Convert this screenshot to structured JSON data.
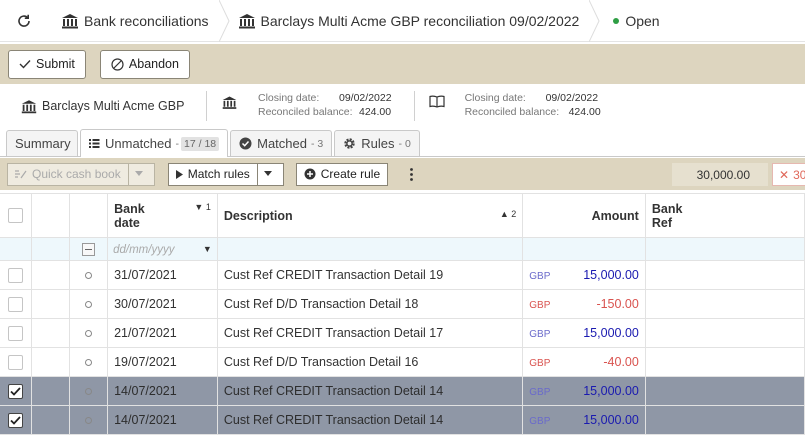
{
  "breadcrumb": {
    "item1": "Bank reconciliations",
    "item2": "Barclays Multi Acme GBP reconciliation 09/02/2022",
    "status": "Open"
  },
  "actions": {
    "submit": "Submit",
    "abandon": "Abandon"
  },
  "info": {
    "account": "Barclays Multi Acme GBP",
    "closing_date_label": "Closing date:",
    "closing_date_1": "09/02/2022",
    "reconciled_balance_label": "Reconciled balance:",
    "reconciled_balance_1": "424.00",
    "closing_date_2": "09/02/2022",
    "reconciled_balance_2": "424.00"
  },
  "tabs": {
    "summary": "Summary",
    "unmatched": "Unmatched",
    "unmatched_count": "17",
    "unmatched_total": "18",
    "matched": "Matched",
    "matched_count": "3",
    "rules": "Rules",
    "rules_count": "0"
  },
  "toolbar": {
    "quick_cash_book": "Quick cash book",
    "match_rules": "Match rules",
    "create_rule": "Create rule",
    "total": "30,000.00",
    "clear": "30"
  },
  "columns": {
    "bank_date_1": "Bank",
    "bank_date_2": "date",
    "bank_date_sort": "1",
    "description": "Description",
    "description_sort": "2",
    "amount": "Amount",
    "bank_ref_1": "Bank",
    "bank_ref_2": "Ref",
    "date_placeholder": "dd/mm/yyyy"
  },
  "rows": [
    {
      "date": "31/07/2021",
      "desc": "Cust Ref CREDIT Transaction Detail 19",
      "cur": "GBP",
      "amount": "15,000.00",
      "neg": false,
      "checked": false
    },
    {
      "date": "30/07/2021",
      "desc": "Cust Ref D/D Transaction Detail 18",
      "cur": "GBP",
      "amount": "-150.00",
      "neg": true,
      "checked": false
    },
    {
      "date": "21/07/2021",
      "desc": "Cust Ref CREDIT Transaction Detail 17",
      "cur": "GBP",
      "amount": "15,000.00",
      "neg": false,
      "checked": false
    },
    {
      "date": "19/07/2021",
      "desc": "Cust Ref D/D Transaction Detail 16",
      "cur": "GBP",
      "amount": "-40.00",
      "neg": true,
      "checked": false
    },
    {
      "date": "14/07/2021",
      "desc": "Cust Ref CREDIT Transaction Detail 14",
      "cur": "GBP",
      "amount": "15,000.00",
      "neg": false,
      "checked": true
    },
    {
      "date": "14/07/2021",
      "desc": "Cust Ref CREDIT Transaction Detail 14",
      "cur": "GBP",
      "amount": "15,000.00",
      "neg": false,
      "checked": true
    }
  ],
  "colors": {
    "accent_bar": "#ddd5bf",
    "selected_row": "#8f97a6",
    "status_open": "#2e9e44",
    "positive_amount": "#1a1ab0",
    "negative_amount": "#d9534f"
  }
}
